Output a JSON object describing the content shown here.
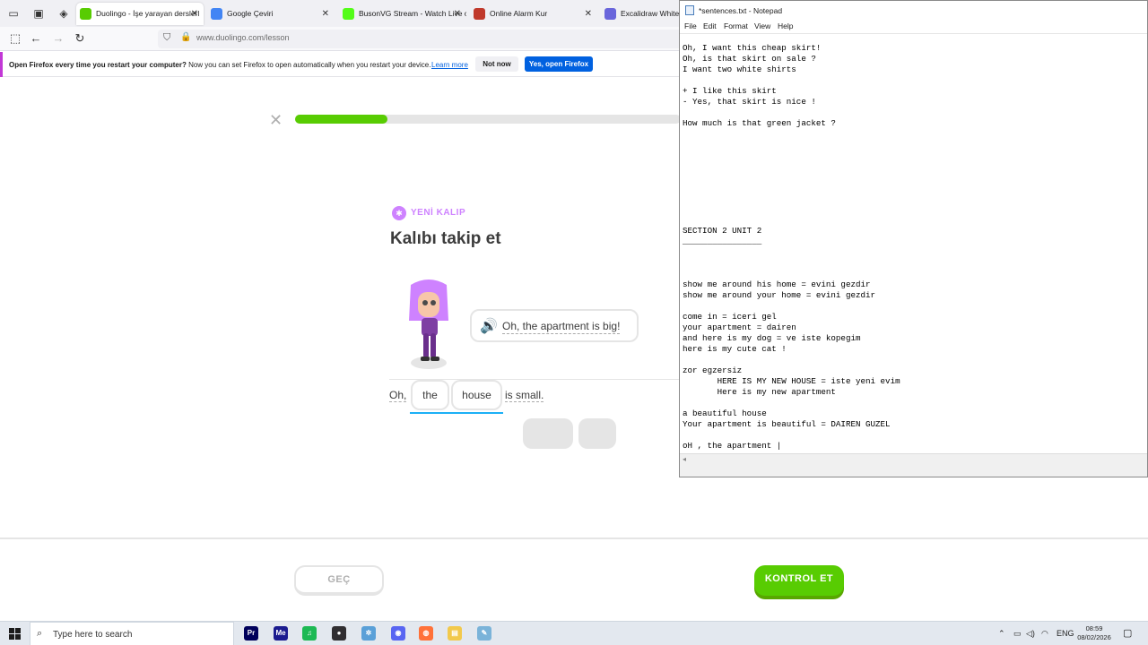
{
  "browser": {
    "tabs": [
      {
        "title": "Duolingo - İşe yarayan derslerl",
        "favicon_color": "#58cc02",
        "active": true
      },
      {
        "title": "Google Çeviri",
        "favicon_color": "#4285f4",
        "active": false
      },
      {
        "title": "BusonVG Stream - Watch Live o",
        "favicon_color": "#53fc18",
        "active": false
      },
      {
        "title": "Online Alarm Kur",
        "favicon_color": "#c0392b",
        "active": false
      },
      {
        "title": "Excalidraw Whitebo",
        "favicon_color": "#6965db",
        "active": false
      }
    ],
    "close_glyph": "✕",
    "url": "www.duolingo.com/lesson",
    "notification": {
      "bold_text": "Open Firefox every time you restart your computer?",
      "text": " Now you can set Firefox to open automatically when you restart your device.",
      "learn_more": "Learn more",
      "not_now": "Not now",
      "yes_button": "Yes, open Firefox"
    }
  },
  "lesson": {
    "progress_fraction": 0.24,
    "close_glyph": "✕",
    "pattern_label": "YENİ KALIP",
    "title": "Kalıbı takip et",
    "speaker_glyph": "🔊",
    "prompt": "Oh, the apartment is big!",
    "sentence_start": "Oh,",
    "chips": [
      "the",
      "house"
    ],
    "sentence_end": "is small.",
    "skip_button": "GEÇ",
    "check_button": "KONTROL ET"
  },
  "notepad": {
    "title": "*sentences.txt - Notepad",
    "menu": [
      "File",
      "Edit",
      "Format",
      "View",
      "Help"
    ],
    "lines": [
      "Oh, I want this cheap skirt!",
      "Oh, is that skirt on sale ?",
      "I want two white shirts",
      "",
      "+ I like this skirt",
      "- Yes, that skirt is nice !",
      "",
      "How much is that green jacket ?",
      "",
      "",
      "",
      "",
      "",
      "",
      "",
      "",
      "",
      "SECTION 2 UNIT 2",
      "________________",
      "",
      "",
      "",
      "show me around his home = evini gezdir",
      "show me around your home = evini gezdir",
      "",
      "come in = iceri gel",
      "your apartment = dairen",
      "and here is my dog = ve iste kopegim",
      "here is my cute cat !",
      "",
      "zor egzersiz",
      "       HERE IS MY NEW HOUSE = iste yeni evim",
      "       Here is my new apartment",
      "",
      "a beautiful house",
      "Your apartment is beautiful = DAIREN GUZEL",
      "",
      "oH , the apartment |"
    ]
  },
  "taskbar": {
    "search_placeholder": "Type here to search",
    "apps": [
      {
        "name": "premiere-pro",
        "label": "Pr",
        "color": "#00005b"
      },
      {
        "name": "media-encoder",
        "label": "Me",
        "color": "#1b1b8f"
      },
      {
        "name": "spotify",
        "label": "♫",
        "color": "#1db954"
      },
      {
        "name": "obs",
        "label": "●",
        "color": "#302e31"
      },
      {
        "name": "app-five",
        "label": "✲",
        "color": "#5aa0d8"
      },
      {
        "name": "discord",
        "label": "◉",
        "color": "#5865f2"
      },
      {
        "name": "firefox",
        "label": "◍",
        "color": "#ff7139"
      },
      {
        "name": "file-explorer",
        "label": "▤",
        "color": "#f2c94c"
      },
      {
        "name": "notepad",
        "label": "✎",
        "color": "#7ab3d9"
      }
    ],
    "language": "ENG",
    "time": "08:59",
    "date": "08/02/2026"
  }
}
